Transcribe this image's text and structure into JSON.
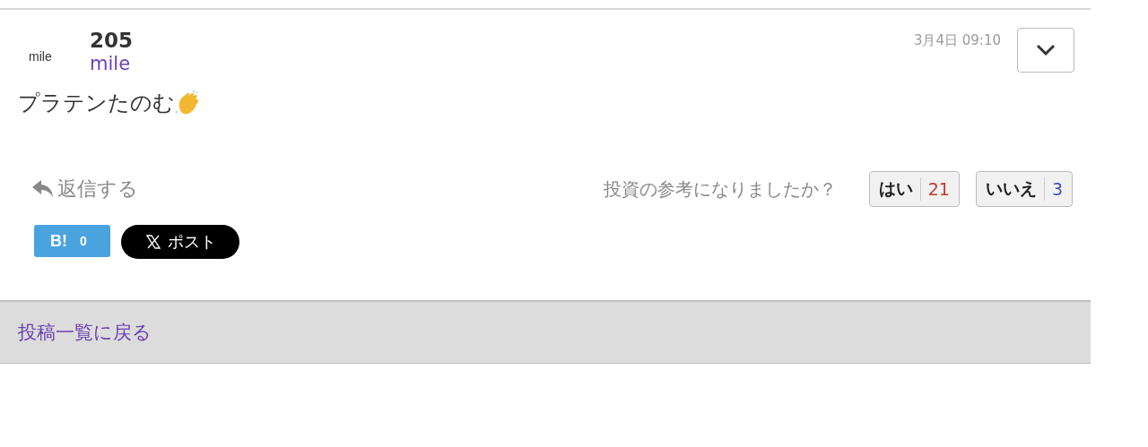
{
  "post": {
    "avatar_text": "mile",
    "number": "205",
    "author": "mile",
    "time": "3月4日 09:10",
    "message": "プラテンたのむ",
    "reply": "返信する",
    "question": "投資の参考になりましたか？",
    "votes": [
      {
        "label": "はい",
        "count": "21",
        "color": "#c0392b"
      },
      {
        "label": "いいえ",
        "count": "3",
        "color": "#3b4fc4"
      }
    ],
    "share": {
      "hatena_label": "B!",
      "hatena_count": "0",
      "x_label": "ポスト"
    }
  },
  "footer": {
    "back_link": "投稿一覧に戻る"
  }
}
